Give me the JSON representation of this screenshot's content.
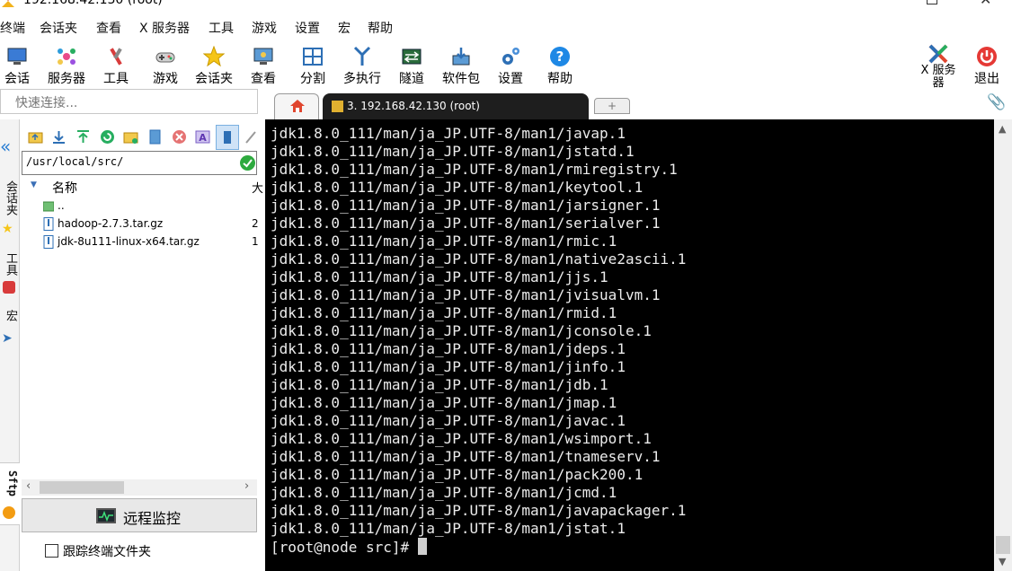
{
  "window": {
    "title": "192.168.42.130 (root)"
  },
  "menu": [
    "终端",
    "会话夹",
    "查看",
    "X 服务器",
    "工具",
    "游戏",
    "设置",
    "宏",
    "帮助"
  ],
  "toolbar": {
    "buttons": [
      {
        "label": "会话",
        "icon": "session-icon"
      },
      {
        "label": "服务器",
        "icon": "servers-icon"
      },
      {
        "label": "工具",
        "icon": "tools-icon"
      },
      {
        "label": "游戏",
        "icon": "games-icon"
      },
      {
        "label": "会话夹",
        "icon": "star-icon"
      },
      {
        "label": "查看",
        "icon": "view-icon"
      },
      {
        "label": "分割",
        "icon": "split-icon"
      },
      {
        "label": "多执行",
        "icon": "multiexec-icon"
      },
      {
        "label": "隧道",
        "icon": "tunnel-icon"
      },
      {
        "label": "软件包",
        "icon": "packages-icon"
      },
      {
        "label": "设置",
        "icon": "settings-icon"
      },
      {
        "label": "帮助",
        "icon": "help-icon"
      }
    ],
    "xserver_label_line1": "X 服务",
    "xserver_label_line2": "器",
    "exit_label": "退出"
  },
  "quick_connect": {
    "placeholder": "快速连接..."
  },
  "side_rail": {
    "tabs": [
      "会话夹",
      "工具",
      "宏",
      "Sftp"
    ]
  },
  "sftp": {
    "path": "/usr/local/src/",
    "column_name": "名称",
    "column_size": "大",
    "files": [
      {
        "name": "..",
        "size": "",
        "type": "parent"
      },
      {
        "name": "hadoop-2.7.3.tar.gz",
        "size": "2",
        "type": "file"
      },
      {
        "name": "jdk-8u111-linux-x64.tar.gz",
        "size": "1",
        "type": "file"
      }
    ],
    "remote_monitor_label": "远程监控",
    "follow_terminal_label": "跟踪终端文件夹",
    "follow_terminal_checked": false
  },
  "tabs": {
    "active_label": "3. 192.168.42.130 (root)",
    "new_tab_symbol": "+"
  },
  "terminal": {
    "lines": [
      "jdk1.8.0_111/man/ja_JP.UTF-8/man1/javap.1",
      "jdk1.8.0_111/man/ja_JP.UTF-8/man1/jstatd.1",
      "jdk1.8.0_111/man/ja_JP.UTF-8/man1/rmiregistry.1",
      "jdk1.8.0_111/man/ja_JP.UTF-8/man1/keytool.1",
      "jdk1.8.0_111/man/ja_JP.UTF-8/man1/jarsigner.1",
      "jdk1.8.0_111/man/ja_JP.UTF-8/man1/serialver.1",
      "jdk1.8.0_111/man/ja_JP.UTF-8/man1/rmic.1",
      "jdk1.8.0_111/man/ja_JP.UTF-8/man1/native2ascii.1",
      "jdk1.8.0_111/man/ja_JP.UTF-8/man1/jjs.1",
      "jdk1.8.0_111/man/ja_JP.UTF-8/man1/jvisualvm.1",
      "jdk1.8.0_111/man/ja_JP.UTF-8/man1/rmid.1",
      "jdk1.8.0_111/man/ja_JP.UTF-8/man1/jconsole.1",
      "jdk1.8.0_111/man/ja_JP.UTF-8/man1/jdeps.1",
      "jdk1.8.0_111/man/ja_JP.UTF-8/man1/jinfo.1",
      "jdk1.8.0_111/man/ja_JP.UTF-8/man1/jdb.1",
      "jdk1.8.0_111/man/ja_JP.UTF-8/man1/jmap.1",
      "jdk1.8.0_111/man/ja_JP.UTF-8/man1/javac.1",
      "jdk1.8.0_111/man/ja_JP.UTF-8/man1/wsimport.1",
      "jdk1.8.0_111/man/ja_JP.UTF-8/man1/tnameserv.1",
      "jdk1.8.0_111/man/ja_JP.UTF-8/man1/pack200.1",
      "jdk1.8.0_111/man/ja_JP.UTF-8/man1/jcmd.1",
      "jdk1.8.0_111/man/ja_JP.UTF-8/man1/javapackager.1",
      "jdk1.8.0_111/man/ja_JP.UTF-8/man1/jstat.1"
    ],
    "prompt": "[root@node src]# "
  },
  "colors": {
    "terminal_bg": "#000000",
    "terminal_fg": "#ececec",
    "active_tab_bg": "#1e1e1e",
    "accent_blue": "#2a7ed3"
  }
}
